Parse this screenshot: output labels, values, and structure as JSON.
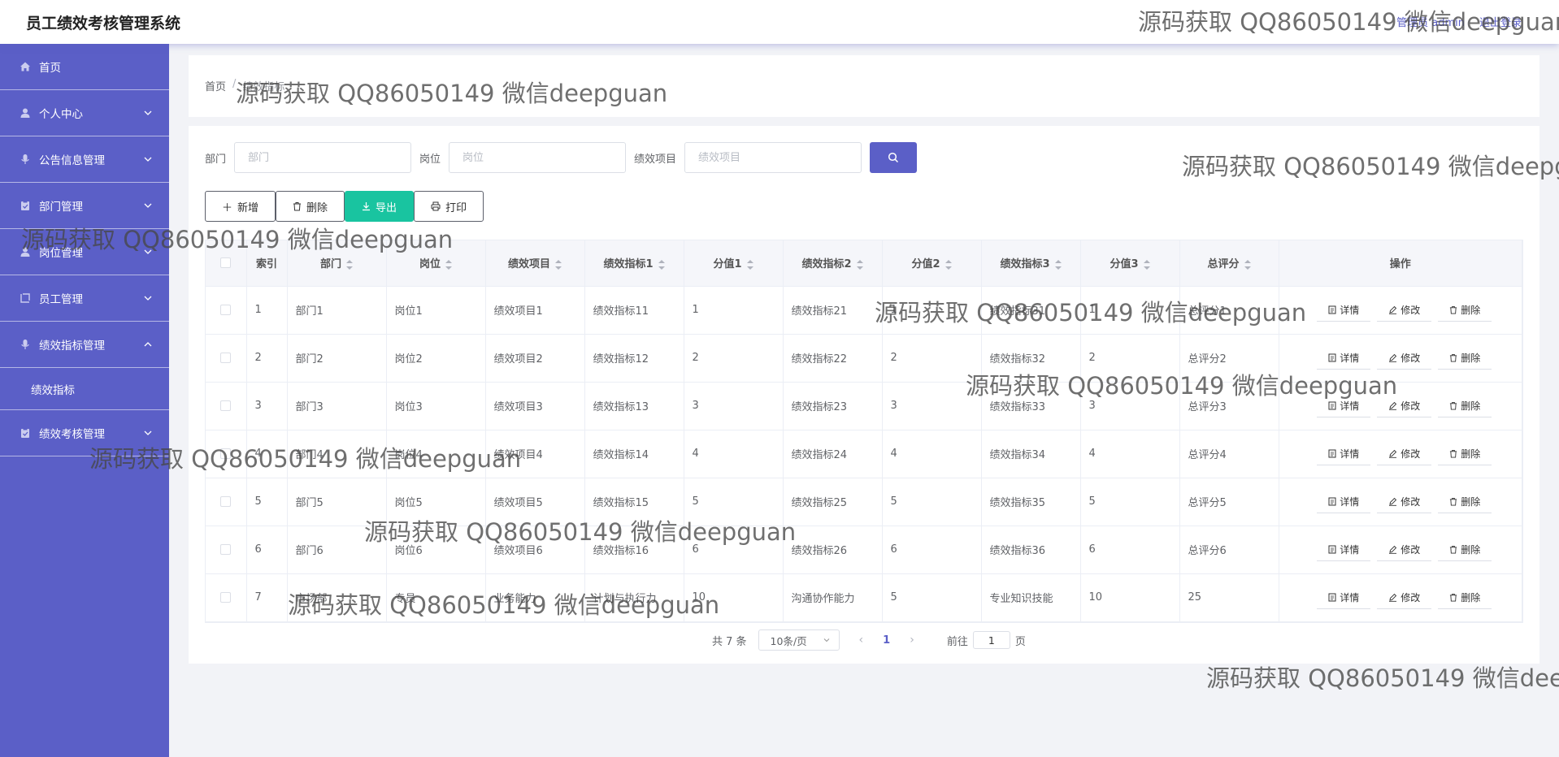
{
  "header": {
    "title": "员工绩效考核管理系统",
    "user_info": "管理员 admin",
    "logout": "退出登录"
  },
  "sidebar": {
    "items": [
      {
        "label": "首页",
        "icon": "home-icon",
        "has_children": false
      },
      {
        "label": "个人中心",
        "icon": "user-icon",
        "has_children": true
      },
      {
        "label": "公告信息管理",
        "icon": "mic-icon",
        "has_children": true
      },
      {
        "label": "部门管理",
        "icon": "clipboard-icon",
        "has_children": true
      },
      {
        "label": "岗位管理",
        "icon": "user-icon",
        "has_children": true
      },
      {
        "label": "员工管理",
        "icon": "frame-icon",
        "has_children": true
      },
      {
        "label": "绩效指标管理",
        "icon": "mic-icon",
        "has_children": true,
        "expanded": true
      },
      {
        "label": "绩效指标",
        "submenu": true
      },
      {
        "label": "绩效考核管理",
        "icon": "clipboard-icon",
        "has_children": true
      }
    ]
  },
  "breadcrumb": {
    "home": "首页",
    "current": "绩效指标"
  },
  "filters": {
    "dept_label": "部门",
    "dept_placeholder": "部门",
    "post_label": "岗位",
    "post_placeholder": "岗位",
    "project_label": "绩效项目",
    "project_placeholder": "绩效项目"
  },
  "actions": {
    "add": "新增",
    "delete": "删除",
    "export": "导出",
    "print": "打印"
  },
  "table": {
    "headers": [
      "索引",
      "部门",
      "岗位",
      "绩效项目",
      "绩效指标1",
      "分值1",
      "绩效指标2",
      "分值2",
      "绩效指标3",
      "分值3",
      "总评分",
      "操作"
    ],
    "op_labels": {
      "detail": "详情",
      "edit": "修改",
      "delete": "删除"
    },
    "rows": [
      [
        "1",
        "部门1",
        "岗位1",
        "绩效项目1",
        "绩效指标11",
        "1",
        "绩效指标21",
        "1",
        "绩效指标31",
        "1",
        "总评分1"
      ],
      [
        "2",
        "部门2",
        "岗位2",
        "绩效项目2",
        "绩效指标12",
        "2",
        "绩效指标22",
        "2",
        "绩效指标32",
        "2",
        "总评分2"
      ],
      [
        "3",
        "部门3",
        "岗位3",
        "绩效项目3",
        "绩效指标13",
        "3",
        "绩效指标23",
        "3",
        "绩效指标33",
        "3",
        "总评分3"
      ],
      [
        "4",
        "部门4",
        "岗位4",
        "绩效项目4",
        "绩效指标14",
        "4",
        "绩效指标24",
        "4",
        "绩效指标34",
        "4",
        "总评分4"
      ],
      [
        "5",
        "部门5",
        "岗位5",
        "绩效项目5",
        "绩效指标15",
        "5",
        "绩效指标25",
        "5",
        "绩效指标35",
        "5",
        "总评分5"
      ],
      [
        "6",
        "部门6",
        "岗位6",
        "绩效项目6",
        "绩效指标16",
        "6",
        "绩效指标26",
        "6",
        "绩效指标36",
        "6",
        "总评分6"
      ],
      [
        "7",
        "市场部",
        "专员",
        "业务能力",
        "计划与执行力",
        "10",
        "沟通协作能力",
        "5",
        "专业知识技能",
        "10",
        "25"
      ]
    ]
  },
  "pagination": {
    "total": "共 7 条",
    "page_size": "10条/页",
    "current_page": "1",
    "goto_label": "前往",
    "goto_value": "1",
    "page_suffix": "页"
  },
  "watermark": "源码获取 QQ86050149 微信deepguan",
  "colors": {
    "primary": "#5b5fc7",
    "export": "#19c4a0",
    "bg": "#f2f3f7"
  }
}
